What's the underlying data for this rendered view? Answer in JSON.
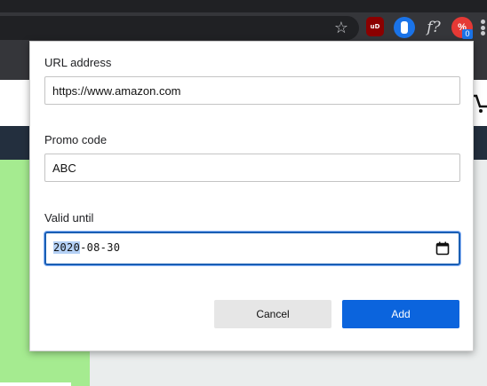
{
  "browser": {
    "toolbar_icons": {
      "bookmark": "star-icon",
      "extensions": [
        "ublock-origin-icon",
        "1password-icon",
        "fx-icon",
        "promo-code-extension-icon"
      ],
      "menu": "kebab-menu-icon"
    },
    "ext_labels": {
      "ublock": "uD",
      "fx": "f?",
      "promo": "%"
    },
    "ext_badge": "0",
    "star_glyph": "☆"
  },
  "form": {
    "url": {
      "label": "URL address",
      "value": "https://www.amazon.com"
    },
    "promo": {
      "label": "Promo code",
      "value": "ABC"
    },
    "valid_until": {
      "label": "Valid until",
      "year": "2020",
      "rest": "-08-30"
    },
    "buttons": {
      "cancel": "Cancel",
      "add": "Add"
    }
  },
  "colors": {
    "primary": "#0b64dd",
    "page_accent": "#a5eb90",
    "page_nav": "#232f3e"
  }
}
